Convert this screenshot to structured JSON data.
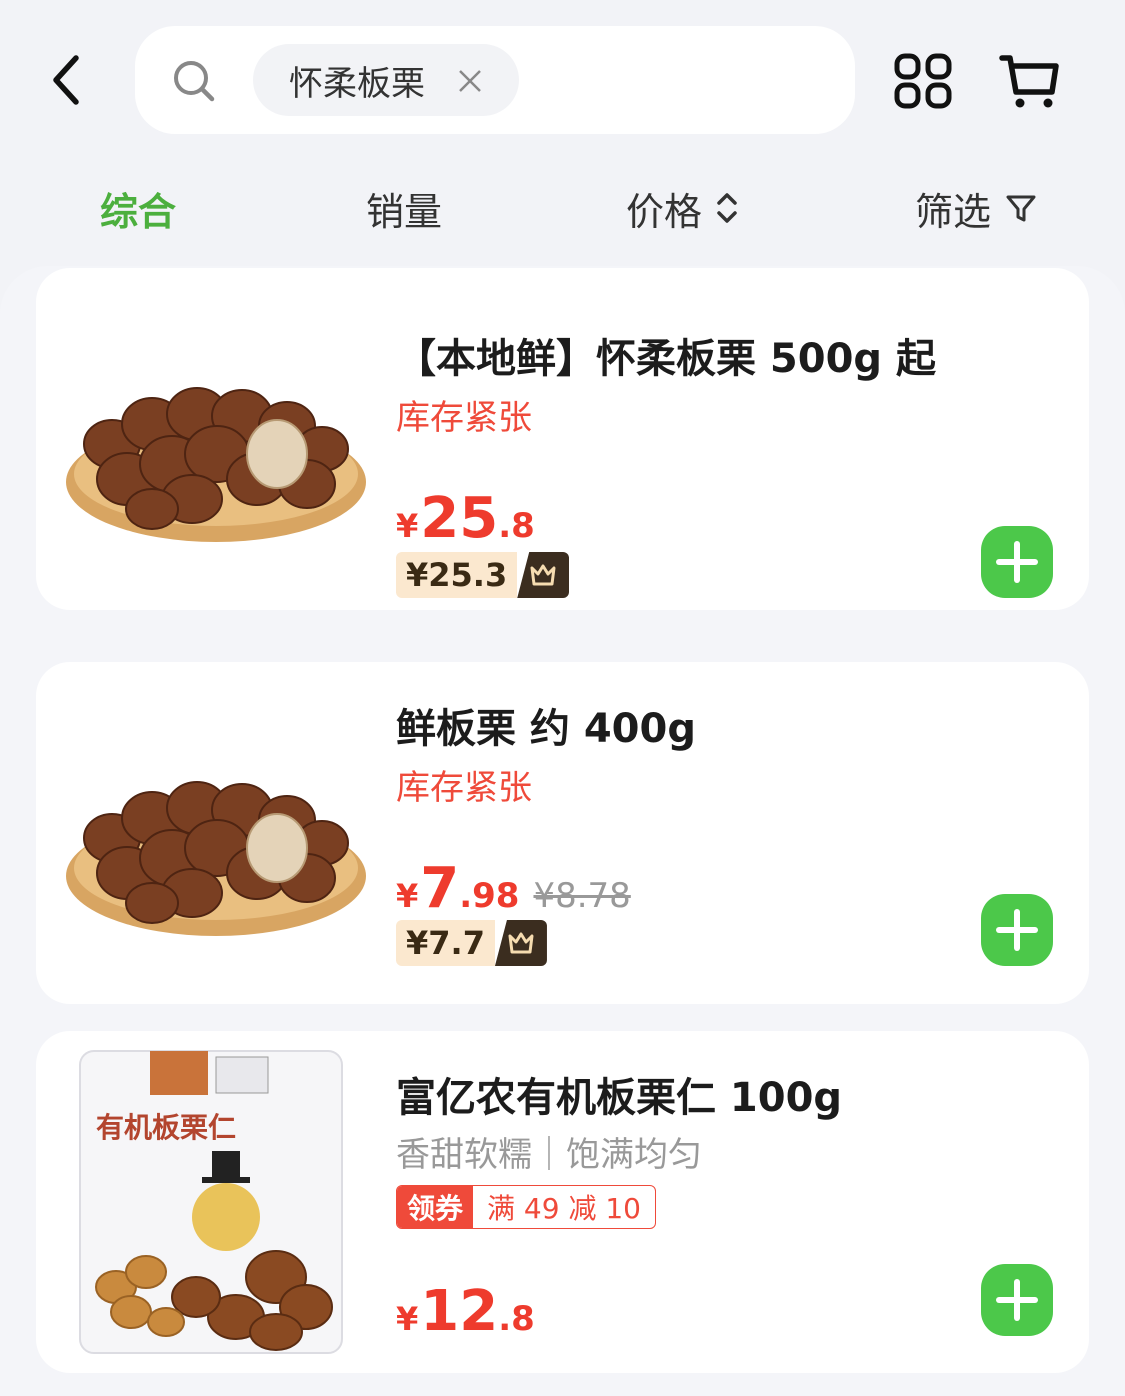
{
  "header": {
    "search_keyword": "怀柔板栗",
    "icons": [
      "back-icon",
      "search-icon",
      "close-icon",
      "grid-icon",
      "cart-icon"
    ]
  },
  "sort_bar": {
    "items": [
      {
        "label": "综合",
        "active": true
      },
      {
        "label": "销量",
        "active": false
      },
      {
        "label": "价格",
        "active": false
      },
      {
        "label": "筛选",
        "active": false
      }
    ]
  },
  "colors": {
    "accent_green": "#4caf3e",
    "price_red": "#ee3b2d",
    "add_button": "#4cc84a",
    "vip_bg": "#fbe8cf"
  },
  "products": [
    {
      "title": "【本地鲜】怀柔板栗 500g 起",
      "stock_label": "库存紧张",
      "price_symbol": "¥",
      "price_int": "25",
      "price_dec": ".8",
      "vip_price": "¥25.3",
      "image": "chestnuts-on-plate"
    },
    {
      "title": "鲜板栗 约 400g",
      "stock_label": "库存紧张",
      "price_symbol": "¥",
      "price_int": "7",
      "price_dec": ".98",
      "original_price": "¥8.78",
      "vip_price": "¥7.7",
      "image": "chestnuts-on-plate"
    },
    {
      "title": "富亿农有机板栗仁 100g",
      "subtitle": "香甜软糯｜饱满均匀",
      "coupon_tag": "领券",
      "coupon_text": "满 49 减 10",
      "price_symbol": "¥",
      "price_int": "12",
      "price_dec": ".8",
      "image": "organic-chestnut-kernel-bag",
      "package_text": "有机板栗仁"
    }
  ]
}
